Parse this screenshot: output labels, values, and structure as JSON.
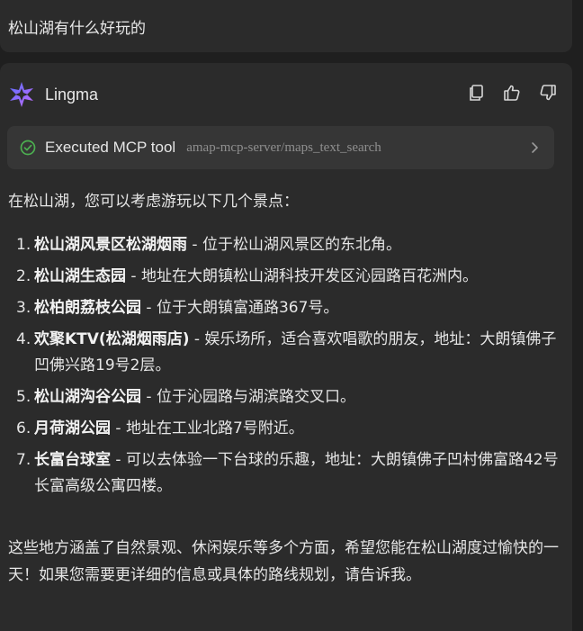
{
  "user_message": "松山湖有什么好玩的",
  "assistant": {
    "name": "Lingma",
    "tool": {
      "status": "Executed MCP tool",
      "name": "amap-mcp-server/maps_text_search"
    },
    "intro": "在松山湖，您可以考虑游玩以下几个景点：",
    "items": [
      {
        "num": "1.",
        "title": "松山湖风景区松湖烟雨",
        "desc": " - 位于松山湖风景区的东北角。"
      },
      {
        "num": "2.",
        "title": "松山湖生态园",
        "desc": " - 地址在大朗镇松山湖科技开发区沁园路百花洲内。"
      },
      {
        "num": "3.",
        "title": "松柏朗荔枝公园",
        "desc": " - 位于大朗镇富通路367号。"
      },
      {
        "num": "4.",
        "title": "欢聚KTV(松湖烟雨店)",
        "desc": " - 娱乐场所，适合喜欢唱歌的朋友，地址：大朗镇佛子凹佛兴路19号2层。"
      },
      {
        "num": "5.",
        "title": "松山湖沟谷公园",
        "desc": " - 位于沁园路与湖滨路交叉口。"
      },
      {
        "num": "6.",
        "title": "月荷湖公园",
        "desc": " - 地址在工业北路7号附近。"
      },
      {
        "num": "7.",
        "title": "长富台球室",
        "desc": " - 可以去体验一下台球的乐趣，地址：大朗镇佛子凹村佛富路42号长富高级公寓四楼。"
      }
    ],
    "outro": "这些地方涵盖了自然景观、休闲娱乐等多个方面，希望您能在松山湖度过愉快的一天！如果您需要更详细的信息或具体的路线规划，请告诉我。"
  },
  "icons": {
    "logo": "lingma-logo-icon",
    "copy": "copy-icon",
    "like": "thumbs-up-icon",
    "dislike": "thumbs-down-icon",
    "status": "check-circle-icon",
    "expand": "chevron-right-icon"
  },
  "colors": {
    "background": "#1f1f1f",
    "card": "#2b2b2b",
    "tool_bar": "#363636",
    "success": "#4caf50",
    "logo_gradient_start": "#5b6cff",
    "logo_gradient_end": "#b46cff"
  }
}
